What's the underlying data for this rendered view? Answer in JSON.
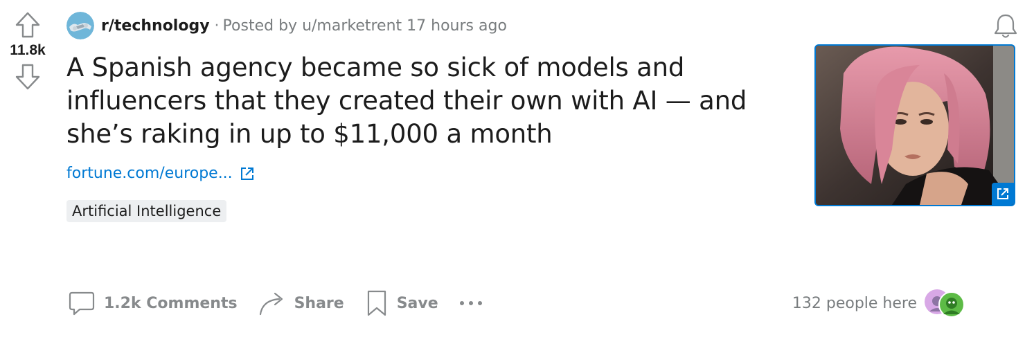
{
  "vote": {
    "score": "11.8k"
  },
  "post": {
    "subreddit": "r/technology",
    "separator": "·",
    "posted_prefix": "Posted by ",
    "author": "u/marketrent",
    "time": " 17 hours ago",
    "title": "A Spanish agency became so sick of models and influencers that they created their own with AI — and she’s raking in up to $11,000 a month",
    "link_text": "fortune.com/europe...",
    "flair": "Artificial Intelligence"
  },
  "actions": {
    "comments_label": "1.2k Comments",
    "share_label": "Share",
    "save_label": "Save"
  },
  "presence": {
    "text": "132 people here"
  },
  "colors": {
    "accent": "#0079d3",
    "muted": "#878a8c",
    "text": "#1c1c1c",
    "flair_bg": "#edeff1"
  },
  "icons": {
    "upvote": "arrow-up-icon",
    "downvote": "arrow-down-icon",
    "bell": "bell-icon",
    "comment": "speech-bubble-icon",
    "share": "curved-arrow-icon",
    "save": "bookmark-icon",
    "more": "ellipsis-icon",
    "external": "external-link-icon"
  }
}
